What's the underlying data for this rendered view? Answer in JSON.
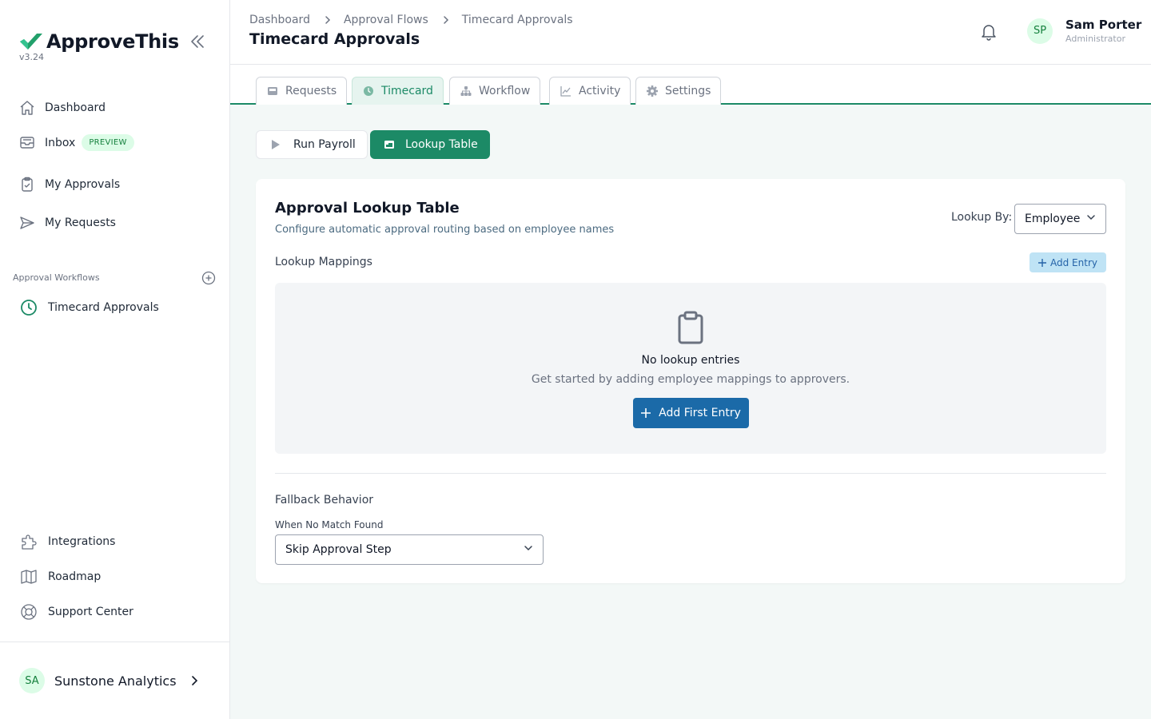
{
  "brand": {
    "name": "ApproveThis",
    "version": "v3.24"
  },
  "sidebar": {
    "items": [
      {
        "label": "Dashboard"
      },
      {
        "label": "Inbox",
        "badge": "PREVIEW"
      },
      {
        "label": "My Approvals"
      },
      {
        "label": "My Requests"
      }
    ],
    "section_title": "Approval Workflows",
    "workflows": [
      {
        "label": "Timecard Approvals"
      }
    ],
    "bottom_items": [
      {
        "label": "Integrations"
      },
      {
        "label": "Roadmap"
      },
      {
        "label": "Support Center"
      }
    ],
    "org": {
      "initials": "SA",
      "name": "Sunstone Analytics"
    }
  },
  "header": {
    "breadcrumb": [
      "Dashboard",
      "Approval Flows",
      "Timecard Approvals"
    ],
    "title": "Timecard Approvals",
    "user": {
      "initials": "SP",
      "name": "Sam Porter",
      "role": "Administrator"
    }
  },
  "tabs": [
    {
      "label": "Requests",
      "icon": "inbox-icon"
    },
    {
      "label": "Timecard",
      "icon": "clock-icon",
      "active": true
    },
    {
      "label": "Workflow",
      "icon": "hierarchy-icon"
    },
    {
      "label": "Activity",
      "icon": "chart-line-icon"
    },
    {
      "label": "Settings",
      "icon": "gear-icon"
    }
  ],
  "actions": {
    "run_payroll": "Run Payroll",
    "lookup_table": "Lookup Table"
  },
  "card": {
    "title": "Approval Lookup Table",
    "subtitle": "Configure automatic approval routing based on employee names",
    "lookup_by_label": "Lookup By:",
    "lookup_by_value": "Employee",
    "mappings_label": "Lookup Mappings",
    "add_entry": "Add Entry",
    "empty": {
      "title": "No lookup entries",
      "subtitle": "Get started by adding employee mappings to approvers.",
      "button": "Add First Entry"
    },
    "fallback": {
      "title": "Fallback Behavior",
      "label": "When No Match Found",
      "value": "Skip Approval Step"
    }
  },
  "colors": {
    "accent": "#1c8a66",
    "primary_blue": "#1b6aa8",
    "background": "#f3f8f7"
  }
}
